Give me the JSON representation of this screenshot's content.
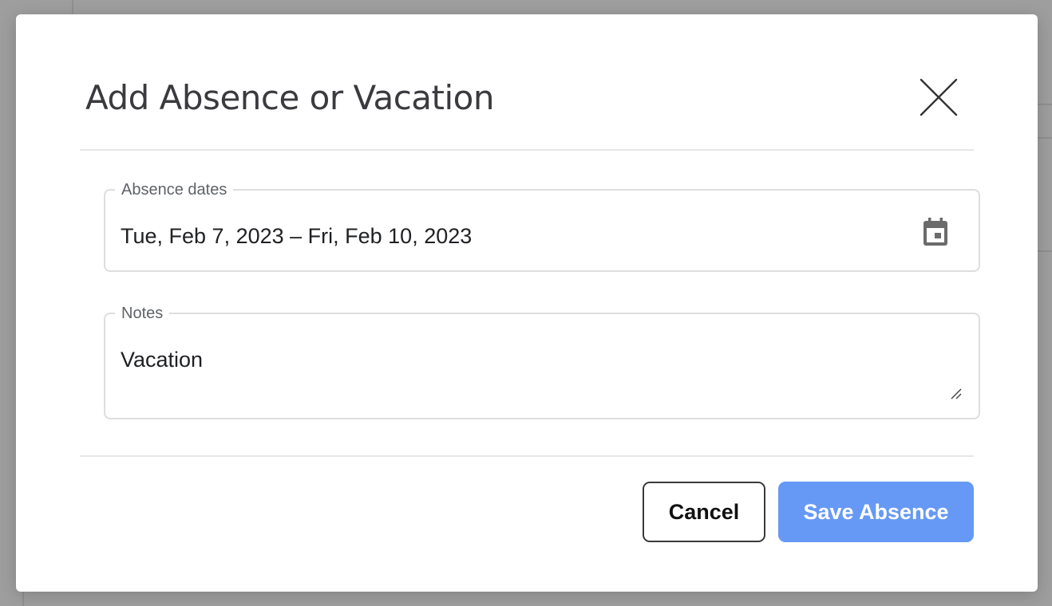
{
  "modal": {
    "title": "Add Absence or Vacation",
    "close_icon": "close-icon"
  },
  "absence_dates": {
    "label": "Absence dates",
    "value": "Tue, Feb 7, 2023 – Fri, Feb 10, 2023",
    "icon": "calendar-icon"
  },
  "notes": {
    "label": "Notes",
    "value": "Vacation"
  },
  "actions": {
    "cancel_label": "Cancel",
    "save_label": "Save Absence"
  },
  "colors": {
    "backdrop": "#9e9e9e",
    "primary_button": "#6699f5",
    "title_text": "#3a3a3f",
    "field_border": "#dedede"
  }
}
